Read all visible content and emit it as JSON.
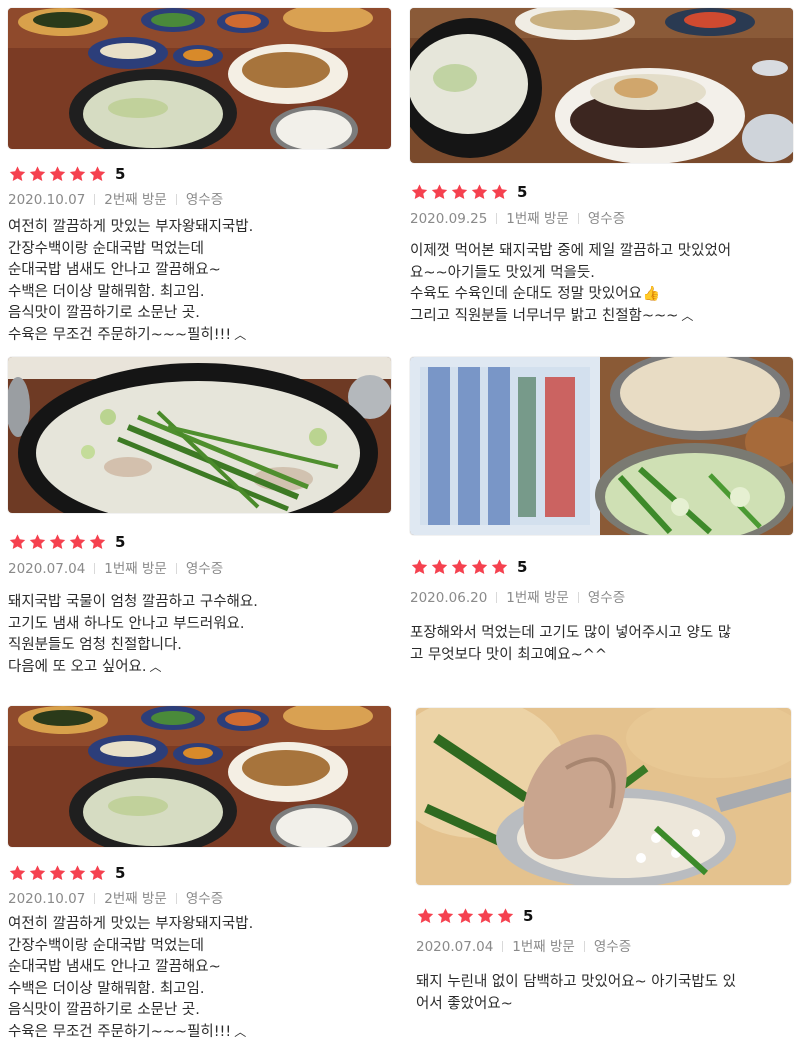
{
  "colors": {
    "star": "#f5414f",
    "meta": "#8a8a8a",
    "text": "#2b2b2b"
  },
  "more_icon": "chevron-up-icon",
  "reviews": [
    {
      "score": "5",
      "date": "2020.10.07",
      "visit": "2번째 방문",
      "receipt": "영수증",
      "lines": [
        "여전히 깔끔하게 맛있는 부자왕돼지국밥.",
        "간장수백이랑 순대국밥 먹었는데",
        "순대국밥 냄새도 안나고 깔끔해요~",
        "수백은 더이상 말해뭐함. 최고임.",
        "음식맛이 깔끔하기로 소문난 곳.",
        "수육은 무조건 주문하기~~~필히!!!"
      ],
      "photo_alt": "Table with gukbap bowl, side dishes, rice and boiled pork"
    },
    {
      "score": "5",
      "date": "2020.09.25",
      "visit": "1번째 방문",
      "receipt": "영수증",
      "lines": [
        "이제껏 먹어본 돼지국밥 중에 제일 깔끔하고 맛있었어",
        "요~~아기들도 맛있게 먹을듯.",
        "수육도 수육인데 순대도 정말 맛있어요",
        "그리고 직원분들 너무너무 밝고 친절함~~~"
      ],
      "thumb": "👍",
      "photo_alt": "Stone pot of pork soup and plate of sundae topped with chives"
    },
    {
      "score": "5",
      "date": "2020.07.04",
      "visit": "1번째 방문",
      "receipt": "영수증",
      "lines": [
        "돼지국밥 국물이 엄청 깔끔하고 구수해요.",
        "고기도 냄새 하나도 안나고 부드러워요.",
        "직원분들도 엄청 친절합니다.",
        "다음에 또 오고 싶어요."
      ],
      "photo_alt": "Milky pork soup topped with chives and green onion"
    },
    {
      "score": "5",
      "date": "2020.06.20",
      "visit": "1번째 방문",
      "receipt": "영수증",
      "lines": [
        "포장해와서 먹었는데 고기도 많이 넣어주시고 양도 많",
        "고 무엇보다 맛이 최고예요~^^"
      ],
      "photo_alt": "Takeout soup with rice and kimchi package"
    },
    {
      "score": "5",
      "date": "2020.10.07",
      "visit": "2번째 방문",
      "receipt": "영수증",
      "lines": [
        "여전히 깔끔하게 맛있는 부자왕돼지국밥.",
        "간장수백이랑 순대국밥 먹었는데",
        "순대국밥 냄새도 안나고 깔끔해요~",
        "수백은 더이상 말해뭐함. 최고임.",
        "음식맛이 깔끔하기로 소문난 곳.",
        "수육은 무조건 주문하기~~~필히!!!"
      ],
      "photo_alt": "Table with gukbap bowl, side dishes, rice and boiled pork"
    },
    {
      "score": "5",
      "date": "2020.07.04",
      "visit": "1번째 방문",
      "receipt": "영수증",
      "lines": [
        "돼지 누린내 없이 담백하고 맛있어요~ 아기국밥도 있",
        "어서 좋았어요~"
      ],
      "photo_alt": "Spoonful of pork and rice in soup"
    }
  ]
}
